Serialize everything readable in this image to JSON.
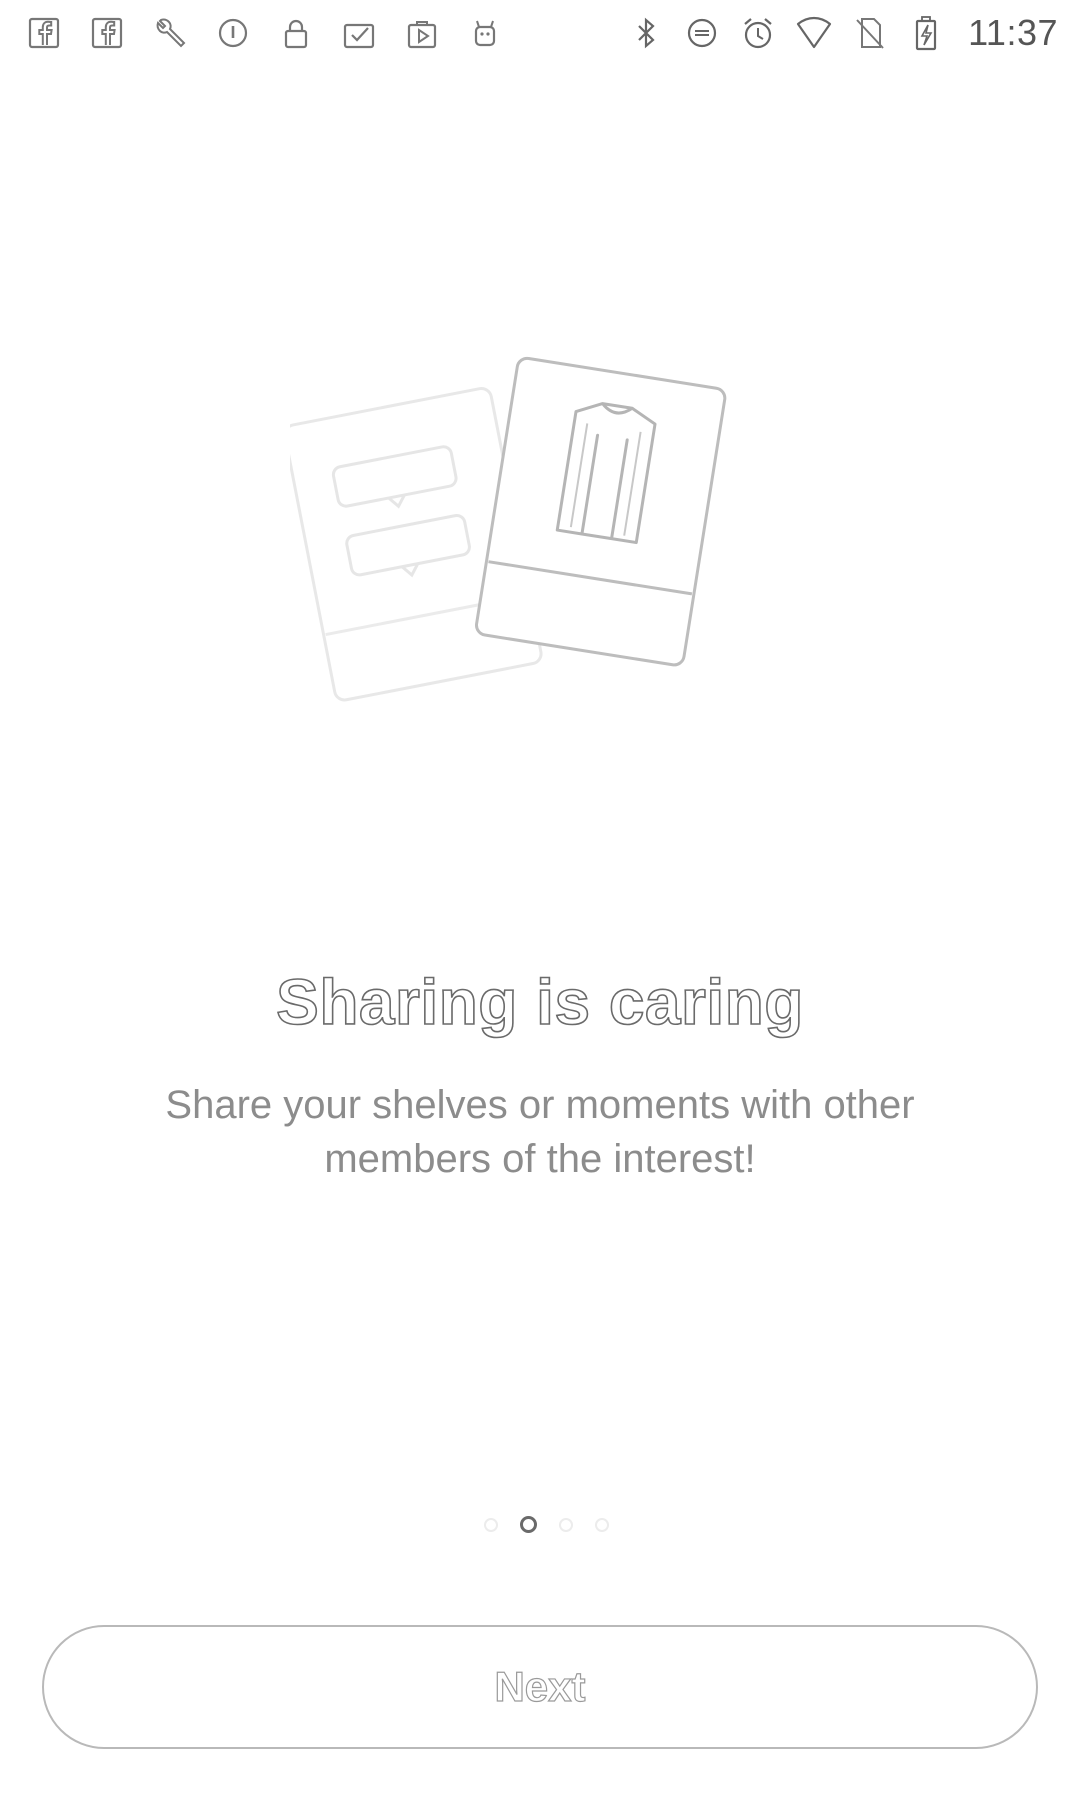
{
  "status_bar": {
    "time": "11:37",
    "left_icons": [
      "facebook-icon",
      "facebook-icon",
      "wrench-icon",
      "info-icon",
      "lock-icon",
      "task-icon",
      "play-store-icon",
      "android-icon"
    ],
    "right_icons": [
      "bluetooth-icon",
      "do-not-disturb-icon",
      "alarm-icon",
      "wifi-icon",
      "no-sim-icon",
      "battery-charging-icon"
    ]
  },
  "onboarding": {
    "title": "Sharing is caring",
    "subtitle_line1": "Share your shelves or moments with other",
    "subtitle_line2": "members of the interest!",
    "illustration": "shared-cards-illustration",
    "pager": {
      "total": 4,
      "active_index": 1
    }
  },
  "actions": {
    "next_label": "Next"
  }
}
